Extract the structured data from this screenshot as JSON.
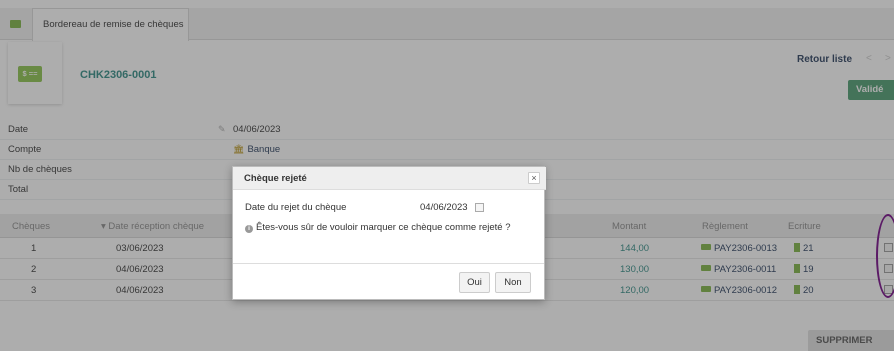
{
  "tab": {
    "label": "Bordereau de remise de chèques",
    "icon": "bank-note-icon"
  },
  "header": {
    "ref": "CHK2306-0001",
    "card_icon_text": "$ ==",
    "back_link": "Retour liste",
    "prev_arrow": "<",
    "next_arrow": ">",
    "validate_label": "Validé"
  },
  "props": {
    "date_label": "Date",
    "date_value": "04/06/2023",
    "account_label": "Compte",
    "account_value": "Banque",
    "count_label": "Nb de chèques",
    "total_label": "Total"
  },
  "table": {
    "columns": [
      "Chèques",
      "Date réception chèque",
      "Montant",
      "Règlement",
      "Ecriture"
    ],
    "sort_indicator": "▾",
    "rows": [
      {
        "num": "1",
        "date": "03/06/2023",
        "amount": "144,00",
        "payment": "PAY2306-0013",
        "entry": "21"
      },
      {
        "num": "2",
        "date": "04/06/2023",
        "amount": "130,00",
        "payment": "PAY2306-0011",
        "entry": "19"
      },
      {
        "num": "3",
        "date": "04/06/2023",
        "amount": "120,00",
        "payment": "PAY2306-0012",
        "entry": "20"
      }
    ]
  },
  "delete_label": "SUPPRIMER",
  "dialog": {
    "title": "Chèque rejeté",
    "close": "×",
    "date_label": "Date du rejet du chèque",
    "date_value": "04/06/2023",
    "question": "Êtes-vous sûr de vouloir marquer ce chèque comme rejeté ?",
    "info_glyph": "i",
    "yes_label": "Oui",
    "no_label": "Non"
  },
  "colors": {
    "accent_teal": "#2e8a83",
    "validate_green": "#4a9b6e",
    "icon_green": "#7cb342",
    "annotation_purple": "#5b1a66",
    "navy": "#263c5c"
  }
}
